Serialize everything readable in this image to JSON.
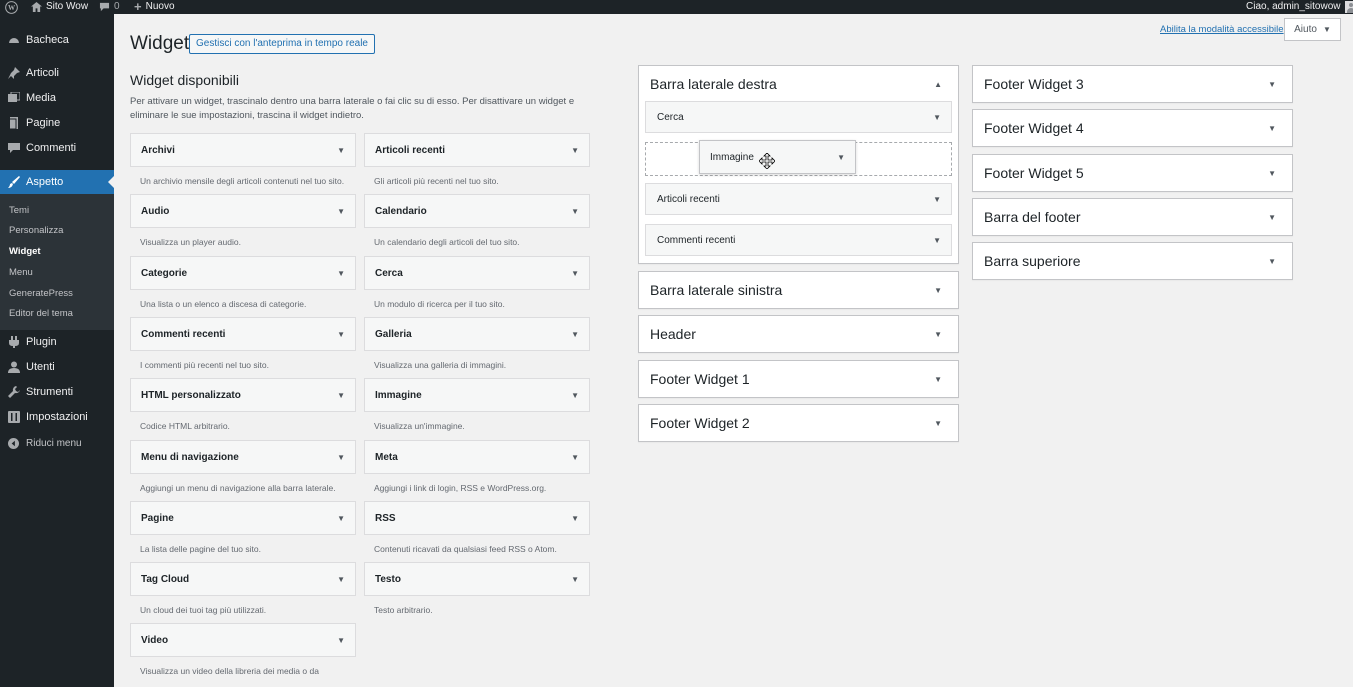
{
  "admin_bar": {
    "site_name": "Sito Wow",
    "comments_count": "0",
    "new_label": "Nuovo",
    "greeting": "Ciao, admin_sitowow"
  },
  "menu": {
    "items": [
      {
        "label": "Bacheca",
        "icon": "dashboard-icon"
      },
      {
        "label": "Articoli",
        "icon": "pin-icon"
      },
      {
        "label": "Media",
        "icon": "media-icon"
      },
      {
        "label": "Pagine",
        "icon": "page-icon"
      },
      {
        "label": "Commenti",
        "icon": "comment-icon"
      },
      {
        "label": "Aspetto",
        "icon": "brush-icon"
      },
      {
        "label": "Plugin",
        "icon": "plugin-icon"
      },
      {
        "label": "Utenti",
        "icon": "users-icon"
      },
      {
        "label": "Strumenti",
        "icon": "tools-icon"
      },
      {
        "label": "Impostazioni",
        "icon": "settings-icon"
      },
      {
        "label": "Riduci menu",
        "icon": "collapse-icon"
      }
    ],
    "submenu": [
      "Temi",
      "Personalizza",
      "Widget",
      "Menu",
      "GeneratePress",
      "Editor del tema"
    ]
  },
  "screen_link": "Abilita la modalità accessibile",
  "help_label": "Aiuto",
  "page_title": "Widget",
  "preview_button": "Gestisci con l'anteprima in tempo reale",
  "available": {
    "title": "Widget disponibili",
    "description": "Per attivare un widget, trascinalo dentro una barra laterale o fai clic su di esso. Per disattivare un widget e eliminare le sue impostazioni, trascina il widget indietro.",
    "widgets": [
      {
        "name": "Archivi",
        "desc": "Un archivio mensile degli articoli contenuti nel tuo sito."
      },
      {
        "name": "Articoli recenti",
        "desc": "Gli articoli più recenti nel tuo sito."
      },
      {
        "name": "Audio",
        "desc": "Visualizza un player audio."
      },
      {
        "name": "Calendario",
        "desc": "Un calendario degli articoli del tuo sito."
      },
      {
        "name": "Categorie",
        "desc": "Una lista o un elenco a discesa di categorie."
      },
      {
        "name": "Cerca",
        "desc": "Un modulo di ricerca per il tuo sito."
      },
      {
        "name": "Commenti recenti",
        "desc": "I commenti più recenti nel tuo sito."
      },
      {
        "name": "Galleria",
        "desc": "Visualizza una galleria di immagini."
      },
      {
        "name": "HTML personalizzato",
        "desc": "Codice HTML arbitrario."
      },
      {
        "name": "Immagine",
        "desc": "Visualizza un'immagine."
      },
      {
        "name": "Menu di navigazione",
        "desc": "Aggiungi un menu di navigazione alla barra laterale."
      },
      {
        "name": "Meta",
        "desc": "Aggiungi i link di login, RSS e WordPress.org."
      },
      {
        "name": "Pagine",
        "desc": "La lista delle pagine del tuo sito."
      },
      {
        "name": "RSS",
        "desc": "Contenuti ricavati da qualsiasi feed RSS o Atom."
      },
      {
        "name": "Tag Cloud",
        "desc": "Un cloud dei tuoi tag più utilizzati."
      },
      {
        "name": "Testo",
        "desc": "Testo arbitrario."
      },
      {
        "name": "Video",
        "desc": "Visualizza un video della libreria dei media o da"
      }
    ]
  },
  "sidebars": {
    "right": {
      "title": "Barra laterale destra",
      "widgets": [
        "Cerca",
        "Articoli recenti",
        "Commenti recenti"
      ]
    },
    "left": [
      "Barra laterale sinistra",
      "Header",
      "Footer Widget 1",
      "Footer Widget 2"
    ],
    "column3": [
      "Footer Widget 3",
      "Footer Widget 4",
      "Footer Widget 5",
      "Barra del footer",
      "Barra superiore"
    ]
  },
  "dragging_widget": "Immagine",
  "colors": {
    "admin_dark": "#1d2327",
    "accent": "#2271b1",
    "background": "#f1f1f1"
  }
}
